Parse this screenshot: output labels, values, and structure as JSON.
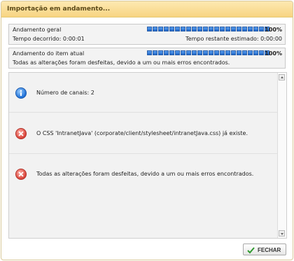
{
  "dialog": {
    "title": "Importação em andamento..."
  },
  "overall": {
    "label": "Andamento geral",
    "percent_text": "100%",
    "progress": 1.0,
    "elapsed": "Tempo decorrido: 0:00:01",
    "remaining": "Tempo restante estimado: 0:00:00"
  },
  "current": {
    "label": "Andamento do item atual",
    "percent_text": "100%",
    "progress": 1.0,
    "status": "Todas as alterações foram desfeitas, devido a um ou mais erros encontrados."
  },
  "messages": [
    {
      "type": "info",
      "icon": "info-icon",
      "text": "Número de canais: 2"
    },
    {
      "type": "error",
      "icon": "error-icon",
      "text": "O CSS 'IntranetJava' (corporate/client/stylesheet/intranetJava.css) já existe."
    },
    {
      "type": "error",
      "icon": "error-icon",
      "text": "Todas as alterações foram desfeitas, devido a um ou mais erros encontrados."
    }
  ],
  "buttons": {
    "close_label": "FECHAR"
  },
  "colors": {
    "title_bar": "#f7d481",
    "progress_fill": "#1f66c8",
    "info_icon": "#1d6fd6",
    "error_icon": "#d9443a"
  }
}
